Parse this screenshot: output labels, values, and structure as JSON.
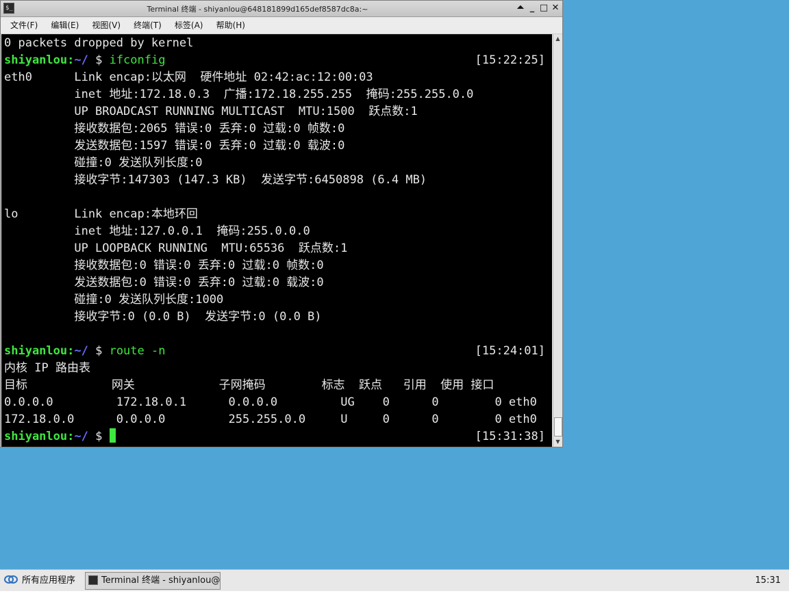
{
  "window": {
    "title": "Terminal 终端 - shiyanlou@648181899d165def8587dc8a:~",
    "app_icon": "terminal-icon",
    "buttons": {
      "shade": "⏶",
      "minimize": "_",
      "maximize": "□",
      "close": "✕"
    }
  },
  "menubar": {
    "items": [
      {
        "label": "文件(F)"
      },
      {
        "label": "编辑(E)"
      },
      {
        "label": "视图(V)"
      },
      {
        "label": "终端(T)"
      },
      {
        "label": "标签(A)"
      },
      {
        "label": "帮助(H)"
      }
    ]
  },
  "terminal": {
    "lines": [
      {
        "text": "0 packets dropped by kernel"
      },
      {
        "user": "shiyanlou",
        "path": "~/",
        "sym": " $ ",
        "cmd": "ifconfig",
        "time": "[15:22:25]"
      },
      {
        "text": "eth0      Link encap:以太网  硬件地址 02:42:ac:12:00:03"
      },
      {
        "text": "          inet 地址:172.18.0.3  广播:172.18.255.255  掩码:255.255.0.0"
      },
      {
        "text": "          UP BROADCAST RUNNING MULTICAST  MTU:1500  跃点数:1"
      },
      {
        "text": "          接收数据包:2065 错误:0 丢弃:0 过载:0 帧数:0"
      },
      {
        "text": "          发送数据包:1597 错误:0 丢弃:0 过载:0 载波:0"
      },
      {
        "text": "          碰撞:0 发送队列长度:0"
      },
      {
        "text": "          接收字节:147303 (147.3 KB)  发送字节:6450898 (6.4 MB)"
      },
      {
        "text": ""
      },
      {
        "text": "lo        Link encap:本地环回"
      },
      {
        "text": "          inet 地址:127.0.0.1  掩码:255.0.0.0"
      },
      {
        "text": "          UP LOOPBACK RUNNING  MTU:65536  跃点数:1"
      },
      {
        "text": "          接收数据包:0 错误:0 丢弃:0 过载:0 帧数:0"
      },
      {
        "text": "          发送数据包:0 错误:0 丢弃:0 过载:0 载波:0"
      },
      {
        "text": "          碰撞:0 发送队列长度:1000"
      },
      {
        "text": "          接收字节:0 (0.0 B)  发送字节:0 (0.0 B)"
      },
      {
        "text": ""
      },
      {
        "user": "shiyanlou",
        "path": "~/",
        "sym": " $ ",
        "cmd": "route -n",
        "time": "[15:24:01]"
      },
      {
        "text": "内核 IP 路由表"
      },
      {
        "text": "目标            网关            子网掩码        标志  跃点   引用  使用 接口"
      },
      {
        "text": "0.0.0.0         172.18.0.1      0.0.0.0         UG    0      0        0 eth0"
      },
      {
        "text": "172.18.0.0      0.0.0.0         255.255.0.0     U     0      0        0 eth0"
      },
      {
        "user": "shiyanlou",
        "path": "~/",
        "sym": " $ ",
        "cmd": "",
        "time": "[15:31:38]",
        "cursor": true
      }
    ]
  },
  "taskbar": {
    "start_label": "所有应用程序",
    "start_icon": "app-menu-icon",
    "task_label": "Terminal 终端 - shiyanlou@…",
    "task_icon": "terminal-icon",
    "clock": "15:31"
  },
  "colors": {
    "desktop": "#4fa6d6",
    "prompt_user": "#3fe63f",
    "prompt_path": "#6b6bff",
    "terminal_bg": "#000000"
  }
}
